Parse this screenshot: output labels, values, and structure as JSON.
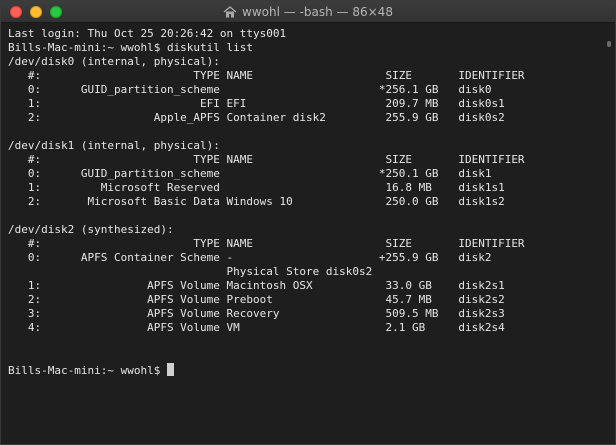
{
  "window": {
    "title": "wwohl — -bash — 86×48"
  },
  "terminal": {
    "lines": [
      "Last login: Thu Oct 25 20:26:42 on ttys001",
      "Bills-Mac-mini:~ wwohl$ diskutil list",
      "/dev/disk0 (internal, physical):",
      "   #:                       TYPE NAME                    SIZE       IDENTIFIER",
      "   0:      GUID_partition_scheme                        *256.1 GB   disk0",
      "   1:                        EFI EFI                     209.7 MB   disk0s1",
      "   2:                 Apple_APFS Container disk2         255.9 GB   disk0s2",
      "",
      "/dev/disk1 (internal, physical):",
      "   #:                       TYPE NAME                    SIZE       IDENTIFIER",
      "   0:      GUID_partition_scheme                        *250.1 GB   disk1",
      "   1:         Microsoft Reserved                         16.8 MB    disk1s1",
      "   2:       Microsoft Basic Data Windows 10              250.0 GB   disk1s2",
      "",
      "/dev/disk2 (synthesized):",
      "   #:                       TYPE NAME                    SIZE       IDENTIFIER",
      "   0:      APFS Container Scheme -                      +255.9 GB   disk2",
      "                                 Physical Store disk0s2",
      "   1:                APFS Volume Macintosh OSX           33.0 GB    disk2s1",
      "   2:                APFS Volume Preboot                 45.7 MB    disk2s2",
      "   3:                APFS Volume Recovery                509.5 MB   disk2s3",
      "   4:                APFS Volume VM                      2.1 GB     disk2s4",
      "",
      ""
    ],
    "prompt": "Bills-Mac-mini:~ wwohl$ "
  }
}
